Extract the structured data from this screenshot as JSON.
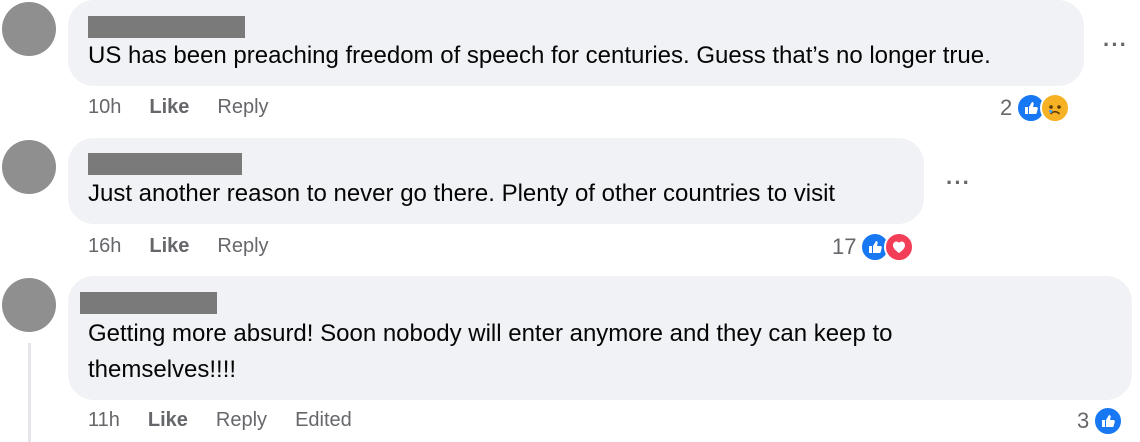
{
  "comments": [
    {
      "text": "US has been preaching freedom of speech for centuries. Guess that’s no longer true.",
      "time": "10h",
      "like": "Like",
      "reply": "Reply",
      "reaction_count": "2",
      "reactions": [
        "like-icon",
        "sad-icon"
      ],
      "more": "···"
    },
    {
      "text": "Just another reason to never go there. Plenty of other countries to visit",
      "time": "16h",
      "like": "Like",
      "reply": "Reply",
      "reaction_count": "17",
      "reactions": [
        "like-icon",
        "love-icon"
      ],
      "more": "···"
    },
    {
      "text": "Getting more absurd! Soon nobody will enter anymore and they can keep to\nthemselves!!!!",
      "time": "11h",
      "like": "Like",
      "reply": "Reply",
      "edited": "Edited",
      "reaction_count": "3",
      "reactions": [
        "like-icon"
      ]
    }
  ],
  "colors": {
    "like": "#1877f2",
    "love": "#f33e58",
    "sad": "#f7b125",
    "bubble": "#f0f2f5",
    "meta": "#65676b"
  }
}
